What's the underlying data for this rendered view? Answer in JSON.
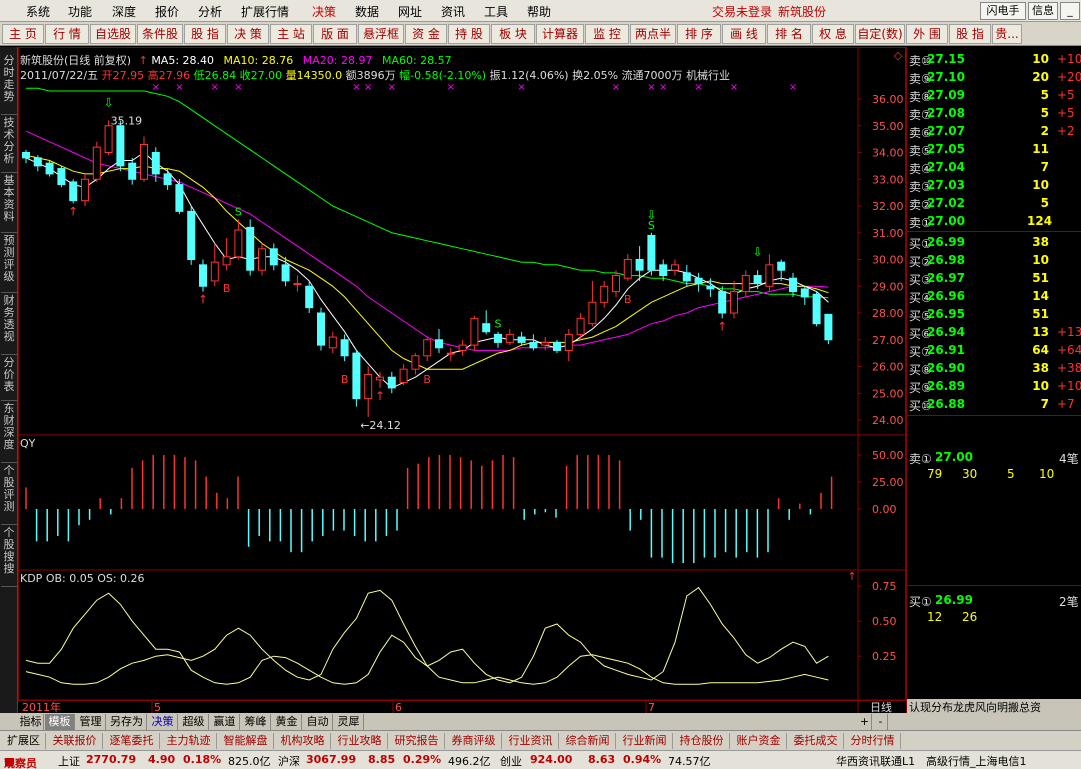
{
  "menu": {
    "items": [
      "系统",
      "功能",
      "深度",
      "报价",
      "分析",
      "扩展行情",
      "决策",
      "数据",
      "网址",
      "资讯",
      "工具",
      "帮助"
    ],
    "active_index": 6,
    "status_text": "交易未登录",
    "stock_name": "新筑股份",
    "btn_flash": "闪电手",
    "btn_info": "信息",
    "btn_minimize": "_",
    "btn_close": "X"
  },
  "toolbar": {
    "buttons": [
      "主 页",
      "行 情",
      "自选股",
      "条件股",
      "股 指",
      "决 策",
      "主 站",
      "版 面",
      "悬浮框",
      "资 金",
      "持 股",
      "板 块",
      "计算器",
      "监 控",
      "两点半",
      "排 序",
      "画 线",
      "排 名",
      "权 息",
      "自定(数)",
      "外 围",
      "股 指",
      "贵..."
    ]
  },
  "sidetabs": [
    "分时走势",
    "技术分析",
    "基本资料",
    "预测评级",
    "财务透视",
    "分价表",
    "东财深度",
    "个股评测",
    "个股搜搜"
  ],
  "chart_header": {
    "title": "新筑股份(日线 前复权)",
    "ma5": "MA5: 28.40",
    "ma10": "MA10: 28.76",
    "ma20": "MA20: 28.97",
    "ma60": "MA60: 28.57",
    "info_date": "2011/07/22/五",
    "info_open": "开27.95",
    "info_high": "高27.96",
    "info_low": "低26.84",
    "info_close": "收27.00",
    "info_vol": "量14350.0",
    "info_amt": "额3896万",
    "info_chg": "幅-0.58(-2.10%)",
    "info_amp": "振1.12(4.06%)",
    "info_turn": "换2.05%",
    "info_float": "流通7000万",
    "info_industry": "机械行业"
  },
  "main_chart": {
    "y_ticks": [
      "36.00",
      "35.00",
      "34.00",
      "33.00",
      "32.00",
      "31.00",
      "30.00",
      "29.00",
      "28.00",
      "27.00",
      "26.00",
      "25.00",
      "24.00"
    ],
    "high_label": "35.19",
    "low_label": "←24.12",
    "x_labels": [
      "2011年",
      "5",
      "6",
      "7"
    ],
    "period_label": "日线"
  },
  "qy_panel": {
    "title": "QY",
    "y_ticks": [
      "50.00",
      "25.00",
      "0.00"
    ]
  },
  "kdp_panel": {
    "title": "KDP OB: 0.05 OS: 0.26",
    "y_ticks": [
      "0.75",
      "0.50",
      "0.25"
    ]
  },
  "orderbook": {
    "sells": [
      {
        "label": "卖⑩",
        "price": "27.15",
        "vol": "10",
        "chg": "+10"
      },
      {
        "label": "卖⑨",
        "price": "27.10",
        "vol": "20",
        "chg": "+20"
      },
      {
        "label": "卖⑧",
        "price": "27.09",
        "vol": "5",
        "chg": "+5"
      },
      {
        "label": "卖⑦",
        "price": "27.08",
        "vol": "5",
        "chg": "+5"
      },
      {
        "label": "卖⑥",
        "price": "27.07",
        "vol": "2",
        "chg": "+2"
      },
      {
        "label": "卖⑤",
        "price": "27.05",
        "vol": "11",
        "chg": ""
      },
      {
        "label": "卖④",
        "price": "27.04",
        "vol": "7",
        "chg": ""
      },
      {
        "label": "卖③",
        "price": "27.03",
        "vol": "10",
        "chg": ""
      },
      {
        "label": "卖②",
        "price": "27.02",
        "vol": "5",
        "chg": ""
      },
      {
        "label": "卖①",
        "price": "27.00",
        "vol": "124",
        "chg": ""
      }
    ],
    "buys": [
      {
        "label": "买①",
        "price": "26.99",
        "vol": "38",
        "chg": ""
      },
      {
        "label": "买②",
        "price": "26.98",
        "vol": "10",
        "chg": ""
      },
      {
        "label": "买③",
        "price": "26.97",
        "vol": "51",
        "chg": ""
      },
      {
        "label": "买④",
        "price": "26.96",
        "vol": "14",
        "chg": ""
      },
      {
        "label": "买⑤",
        "price": "26.95",
        "vol": "51",
        "chg": ""
      },
      {
        "label": "买⑥",
        "price": "26.94",
        "vol": "13",
        "chg": "+13"
      },
      {
        "label": "买⑦",
        "price": "26.91",
        "vol": "64",
        "chg": "+64"
      },
      {
        "label": "买⑧",
        "price": "26.90",
        "vol": "38",
        "chg": "+38"
      },
      {
        "label": "买⑨",
        "price": "26.89",
        "vol": "10",
        "chg": "+10"
      },
      {
        "label": "买⑩",
        "price": "26.88",
        "vol": "7",
        "chg": "+7"
      }
    ],
    "sell1_detail": {
      "label": "卖①",
      "price": "27.00",
      "count": "4笔",
      "q1": "79",
      "q2": "30",
      "q3": "5",
      "q4": "10"
    },
    "buy1_detail": {
      "label": "买①",
      "price": "26.99",
      "count": "2笔",
      "q1": "12",
      "q2": "26"
    },
    "bottom_tabs": "认现分布龙虎风向明搬总资"
  },
  "bottom_tabs": {
    "items": [
      "指标",
      "模板",
      "管理",
      "另存为",
      "决策",
      "超级",
      "赢道",
      "筹峰",
      "黄金",
      "自动",
      "灵犀"
    ],
    "plus": "+",
    "minus": "-"
  },
  "links": [
    "扩展区",
    "关联报价",
    "逐笔委托",
    "主力轨迹",
    "智能解盘",
    "机构攻略",
    "行业攻略",
    "研究报告",
    "券商评级",
    "行业资讯",
    "综合新闻",
    "行业新闻",
    "持仓股份",
    "账户资金",
    "委托成交",
    "分时行情"
  ],
  "statusbar": {
    "user": "观察员",
    "sh_label": "上证",
    "sh_index": "2770.79",
    "sh_chg": "4.90",
    "sh_pct": "0.18%",
    "sh_amt": "825.0亿",
    "sz_label": "沪深",
    "sz_index": "3067.99",
    "sz_chg": "8.85",
    "sz_pct": "0.29%",
    "sz_amt": "496.2亿",
    "cy_label": "创业",
    "cy_index": "924.00",
    "cy_chg": "8.63",
    "cy_pct": "0.94%",
    "cy_amt": "74.57亿",
    "feed": "华西资讯联通L1",
    "feed2": "高级行情_上海电信1"
  },
  "colors": {
    "up": "#ff3232",
    "down": "#54ffff",
    "ma5": "#ffffff",
    "ma10": "#ffff00",
    "ma20": "#ff00ff",
    "ma60": "#00ff00",
    "grid": "#8b0000"
  },
  "chart_data": {
    "type": "candlestick",
    "title": "新筑股份(日线 前复权)",
    "ylim": [
      24.0,
      36.0
    ],
    "candles": [
      {
        "o": 34.0,
        "c": 33.8,
        "h": 34.1,
        "l": 33.6
      },
      {
        "o": 33.8,
        "c": 33.5,
        "h": 33.9,
        "l": 33.3
      },
      {
        "o": 33.6,
        "c": 33.2,
        "h": 33.7,
        "l": 33.1
      },
      {
        "o": 33.4,
        "c": 32.8,
        "h": 33.5,
        "l": 32.7
      },
      {
        "o": 32.9,
        "c": 32.2,
        "h": 33.0,
        "l": 32.1
      },
      {
        "o": 32.2,
        "c": 33.0,
        "h": 33.2,
        "l": 32.0
      },
      {
        "o": 33.0,
        "c": 34.2,
        "h": 34.4,
        "l": 32.9
      },
      {
        "o": 34.0,
        "c": 35.0,
        "h": 35.2,
        "l": 33.9
      },
      {
        "o": 35.0,
        "c": 33.5,
        "h": 35.19,
        "l": 33.3
      },
      {
        "o": 33.6,
        "c": 33.0,
        "h": 33.8,
        "l": 32.8
      },
      {
        "o": 33.0,
        "c": 34.3,
        "h": 34.6,
        "l": 32.9
      },
      {
        "o": 34.0,
        "c": 33.2,
        "h": 34.2,
        "l": 32.9
      },
      {
        "o": 33.2,
        "c": 32.8,
        "h": 33.4,
        "l": 32.6
      },
      {
        "o": 32.8,
        "c": 31.8,
        "h": 33.0,
        "l": 31.7
      },
      {
        "o": 31.8,
        "c": 30.0,
        "h": 32.0,
        "l": 29.8
      },
      {
        "o": 29.8,
        "c": 29.0,
        "h": 30.0,
        "l": 28.8
      },
      {
        "o": 29.2,
        "c": 29.9,
        "h": 30.6,
        "l": 29.0
      },
      {
        "o": 29.8,
        "c": 30.1,
        "h": 30.8,
        "l": 29.6
      },
      {
        "o": 30.1,
        "c": 31.1,
        "h": 31.5,
        "l": 30.0
      },
      {
        "o": 31.2,
        "c": 29.6,
        "h": 31.5,
        "l": 29.4
      },
      {
        "o": 29.6,
        "c": 30.4,
        "h": 30.6,
        "l": 29.4
      },
      {
        "o": 30.4,
        "c": 29.8,
        "h": 30.6,
        "l": 29.6
      },
      {
        "o": 29.8,
        "c": 29.2,
        "h": 30.1,
        "l": 29.0
      },
      {
        "o": 29.1,
        "c": 29.1,
        "h": 29.4,
        "l": 28.8
      },
      {
        "o": 29.0,
        "c": 28.2,
        "h": 29.2,
        "l": 28.0
      },
      {
        "o": 28.0,
        "c": 26.8,
        "h": 28.2,
        "l": 26.6
      },
      {
        "o": 26.7,
        "c": 27.1,
        "h": 27.3,
        "l": 26.5
      },
      {
        "o": 27.0,
        "c": 26.4,
        "h": 27.2,
        "l": 26.2
      },
      {
        "o": 26.5,
        "c": 24.8,
        "h": 26.6,
        "l": 24.5
      },
      {
        "o": 24.8,
        "c": 25.7,
        "h": 26.0,
        "l": 24.12
      },
      {
        "o": 25.5,
        "c": 25.6,
        "h": 25.8,
        "l": 25.2
      },
      {
        "o": 25.6,
        "c": 25.2,
        "h": 25.8,
        "l": 25.0
      },
      {
        "o": 25.4,
        "c": 25.9,
        "h": 26.1,
        "l": 25.3
      },
      {
        "o": 25.9,
        "c": 26.4,
        "h": 26.5,
        "l": 25.7
      },
      {
        "o": 26.4,
        "c": 27.0,
        "h": 27.1,
        "l": 26.2
      },
      {
        "o": 27.0,
        "c": 26.7,
        "h": 27.4,
        "l": 26.5
      },
      {
        "o": 26.5,
        "c": 26.5,
        "h": 26.7,
        "l": 26.2
      },
      {
        "o": 26.6,
        "c": 26.8,
        "h": 27.0,
        "l": 26.4
      },
      {
        "o": 26.8,
        "c": 27.8,
        "h": 27.9,
        "l": 26.6
      },
      {
        "o": 27.6,
        "c": 27.3,
        "h": 28.1,
        "l": 27.2
      },
      {
        "o": 27.2,
        "c": 26.9,
        "h": 27.3,
        "l": 26.7
      },
      {
        "o": 26.9,
        "c": 27.2,
        "h": 27.4,
        "l": 26.8
      },
      {
        "o": 27.1,
        "c": 26.9,
        "h": 27.3,
        "l": 26.8
      },
      {
        "o": 26.9,
        "c": 26.7,
        "h": 27.2,
        "l": 26.6
      },
      {
        "o": 26.8,
        "c": 26.9,
        "h": 27.1,
        "l": 26.6
      },
      {
        "o": 26.9,
        "c": 26.6,
        "h": 27.0,
        "l": 26.5
      },
      {
        "o": 26.6,
        "c": 27.2,
        "h": 27.4,
        "l": 26.2
      },
      {
        "o": 27.2,
        "c": 27.8,
        "h": 28.0,
        "l": 27.0
      },
      {
        "o": 27.6,
        "c": 28.4,
        "h": 29.2,
        "l": 27.5
      },
      {
        "o": 28.4,
        "c": 29.0,
        "h": 29.2,
        "l": 28.2
      },
      {
        "o": 28.8,
        "c": 29.4,
        "h": 29.6,
        "l": 28.6
      },
      {
        "o": 29.3,
        "c": 30.0,
        "h": 30.2,
        "l": 29.2
      },
      {
        "o": 30.0,
        "c": 29.6,
        "h": 30.5,
        "l": 29.2
      },
      {
        "o": 30.9,
        "c": 29.6,
        "h": 31.0,
        "l": 29.4
      },
      {
        "o": 29.8,
        "c": 29.4,
        "h": 30.0,
        "l": 29.2
      },
      {
        "o": 29.6,
        "c": 29.8,
        "h": 30.0,
        "l": 29.4
      },
      {
        "o": 29.5,
        "c": 29.2,
        "h": 29.8,
        "l": 29.0
      },
      {
        "o": 29.3,
        "c": 29.1,
        "h": 29.5,
        "l": 28.8
      },
      {
        "o": 29.0,
        "c": 28.9,
        "h": 29.3,
        "l": 28.6
      },
      {
        "o": 28.8,
        "c": 28.0,
        "h": 29.0,
        "l": 27.8
      },
      {
        "o": 28.0,
        "c": 28.8,
        "h": 29.2,
        "l": 27.8
      },
      {
        "o": 28.8,
        "c": 29.4,
        "h": 29.6,
        "l": 28.6
      },
      {
        "o": 29.4,
        "c": 29.1,
        "h": 29.6,
        "l": 28.9
      },
      {
        "o": 29.0,
        "c": 29.8,
        "h": 30.2,
        "l": 28.8
      },
      {
        "o": 29.9,
        "c": 29.6,
        "h": 30.0,
        "l": 29.2
      },
      {
        "o": 29.3,
        "c": 28.8,
        "h": 29.5,
        "l": 28.6
      },
      {
        "o": 28.9,
        "c": 28.6,
        "h": 29.0,
        "l": 28.3
      },
      {
        "o": 28.7,
        "c": 27.6,
        "h": 28.8,
        "l": 27.5
      },
      {
        "o": 27.95,
        "c": 27.0,
        "h": 27.96,
        "l": 26.84
      }
    ],
    "ma5": [
      33.8,
      33.6,
      33.4,
      33.1,
      32.8,
      32.7,
      33.0,
      33.4,
      33.7,
      33.7,
      34.0,
      33.6,
      33.3,
      32.8,
      32.0,
      31.3,
      30.6,
      30.0,
      30.1,
      30.0,
      30.1,
      30.1,
      29.9,
      29.6,
      29.2,
      28.5,
      27.9,
      27.3,
      26.6,
      26.1,
      25.6,
      25.2,
      25.4,
      25.6,
      25.9,
      26.2,
      26.5,
      26.6,
      26.9,
      27.0,
      27.1,
      27.0,
      27.0,
      27.0,
      26.8,
      26.7,
      26.8,
      27.1,
      27.4,
      27.8,
      28.3,
      28.9,
      29.3,
      29.6,
      29.6,
      29.6,
      29.5,
      29.3,
      29.1,
      28.8,
      28.7,
      28.9,
      29.0,
      29.2,
      29.3,
      29.2,
      29.0,
      28.8,
      28.4
    ],
    "ma10": [
      33.9,
      33.8,
      33.7,
      33.5,
      33.3,
      33.2,
      33.2,
      33.3,
      33.4,
      33.4,
      33.5,
      33.4,
      33.4,
      33.3,
      33.0,
      32.7,
      32.3,
      31.8,
      31.4,
      31.0,
      30.6,
      30.3,
      30.0,
      29.8,
      29.6,
      29.3,
      29.0,
      28.6,
      28.1,
      27.6,
      27.1,
      26.6,
      26.3,
      26.1,
      25.9,
      25.9,
      25.9,
      25.9,
      26.1,
      26.3,
      26.5,
      26.6,
      26.8,
      26.9,
      26.9,
      26.9,
      26.9,
      27.0,
      27.1,
      27.3,
      27.5,
      27.8,
      28.1,
      28.4,
      28.6,
      28.8,
      29.0,
      29.1,
      29.2,
      29.1,
      29.1,
      29.1,
      29.1,
      29.1,
      29.1,
      29.0,
      29.0,
      28.9,
      28.76
    ],
    "ma20": [
      34.8,
      34.6,
      34.4,
      34.2,
      34.0,
      33.8,
      33.6,
      33.5,
      33.4,
      33.3,
      33.2,
      33.1,
      33.0,
      32.9,
      32.7,
      32.5,
      32.3,
      32.1,
      31.9,
      31.7,
      31.4,
      31.1,
      30.8,
      30.5,
      30.2,
      29.9,
      29.6,
      29.3,
      29.0,
      28.6,
      28.3,
      28.0,
      27.7,
      27.4,
      27.1,
      26.9,
      26.8,
      26.7,
      26.6,
      26.6,
      26.6,
      26.6,
      26.7,
      26.7,
      26.7,
      26.7,
      26.8,
      26.8,
      26.9,
      27.0,
      27.1,
      27.2,
      27.4,
      27.6,
      27.7,
      27.9,
      28.0,
      28.2,
      28.3,
      28.4,
      28.5,
      28.6,
      28.7,
      28.8,
      28.9,
      29.0,
      29.0,
      29.0,
      28.97
    ],
    "ma60": [
      36.4,
      36.4,
      36.3,
      36.3,
      36.3,
      36.3,
      36.3,
      36.3,
      36.3,
      36.3,
      36.3,
      36.2,
      36.1,
      35.9,
      35.6,
      35.3,
      35.0,
      34.7,
      34.4,
      34.1,
      33.8,
      33.5,
      33.2,
      32.9,
      32.6,
      32.3,
      32.0,
      31.8,
      31.6,
      31.4,
      31.2,
      31.0,
      30.9,
      30.8,
      30.7,
      30.6,
      30.5,
      30.4,
      30.3,
      30.2,
      30.1,
      30.0,
      29.9,
      29.9,
      29.8,
      29.8,
      29.7,
      29.6,
      29.6,
      29.5,
      29.5,
      29.4,
      29.4,
      29.3,
      29.3,
      29.2,
      29.1,
      29.1,
      29.0,
      28.9,
      28.9,
      28.8,
      28.8,
      28.7,
      28.7,
      28.7,
      28.6,
      28.6,
      28.57
    ],
    "qy": [
      20,
      -30,
      -30,
      -25,
      -30,
      -15,
      -10,
      10,
      -5,
      10,
      38,
      45,
      50,
      50,
      50,
      48,
      45,
      30,
      15,
      10,
      30,
      -35,
      -25,
      -30,
      -30,
      -40,
      -40,
      -30,
      -25,
      -20,
      -20,
      -25,
      -30,
      -30,
      -25,
      -20,
      38,
      42,
      48,
      50,
      50,
      48,
      45,
      40,
      45,
      50,
      48,
      -10,
      -5,
      -3,
      -8,
      40,
      50,
      50,
      50,
      50,
      45,
      -20,
      -10,
      -45,
      -45,
      -50,
      -50,
      -50,
      -45,
      -45,
      -40,
      -45,
      -40,
      -45,
      -40,
      10,
      -10,
      5,
      -5,
      15,
      30
    ],
    "kdp_line1": [
      0.22,
      0.2,
      0.2,
      0.3,
      0.45,
      0.55,
      0.65,
      0.7,
      0.62,
      0.5,
      0.4,
      0.3,
      0.3,
      0.28,
      0.15,
      0.1,
      0.06,
      0.05,
      0.06,
      0.1,
      0.22,
      0.25,
      0.24,
      0.2,
      0.15,
      0.1,
      0.06,
      0.05,
      0.06,
      0.12,
      0.28,
      0.4,
      0.35,
      0.24,
      0.18,
      0.22,
      0.28,
      0.3,
      0.2,
      0.12,
      0.08,
      0.06,
      0.1,
      0.25,
      0.45,
      0.48,
      0.4,
      0.35,
      0.25,
      0.18,
      0.15,
      0.12,
      0.1,
      0.08,
      0.14,
      0.35,
      0.68,
      0.74,
      0.62,
      0.48,
      0.38,
      0.26,
      0.2,
      0.24,
      0.3,
      0.35,
      0.32,
      0.2,
      0.25
    ],
    "kdp_line2": [
      0.14,
      0.12,
      0.1,
      0.06,
      0.05,
      0.05,
      0.06,
      0.1,
      0.16,
      0.2,
      0.22,
      0.25,
      0.26,
      0.24,
      0.22,
      0.25,
      0.3,
      0.4,
      0.45,
      0.4,
      0.3,
      0.22,
      0.15,
      0.1,
      0.08,
      0.12,
      0.3,
      0.42,
      0.52,
      0.7,
      0.72,
      0.65,
      0.48,
      0.32,
      0.18,
      0.1,
      0.08,
      0.06,
      0.06,
      0.08,
      0.1,
      0.08,
      0.06,
      0.05,
      0.06,
      0.1,
      0.18,
      0.25,
      0.26,
      0.24,
      0.22,
      0.2,
      0.16,
      0.1,
      0.06,
      0.05,
      0.05,
      0.05,
      0.06,
      0.06,
      0.06,
      0.06,
      0.06,
      0.07,
      0.08,
      0.1,
      0.12,
      0.1,
      0.08
    ]
  }
}
